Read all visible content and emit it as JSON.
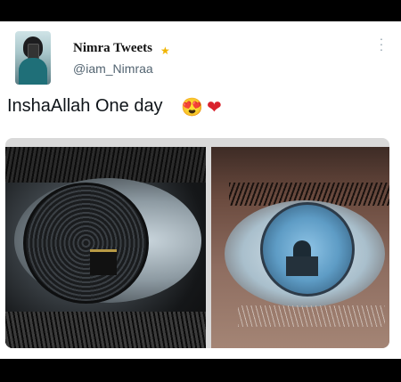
{
  "tweet": {
    "display_name": "Nimra Tweets",
    "handle": "@iam_Nimraa",
    "text": "InshaAllah One day",
    "emojis": [
      "😍",
      "❤"
    ],
    "name_badge_icon": "star-icon",
    "more_icon": "more-vertical-icon"
  },
  "media": {
    "images": [
      {
        "icon": "kaaba-in-eye-image"
      },
      {
        "icon": "mosque-in-eye-image"
      }
    ]
  },
  "colors": {
    "handle_gray": "#536471",
    "text_dark": "#0f1419",
    "heart_red": "#d9232d",
    "background": "#000000",
    "card": "#ffffff"
  }
}
